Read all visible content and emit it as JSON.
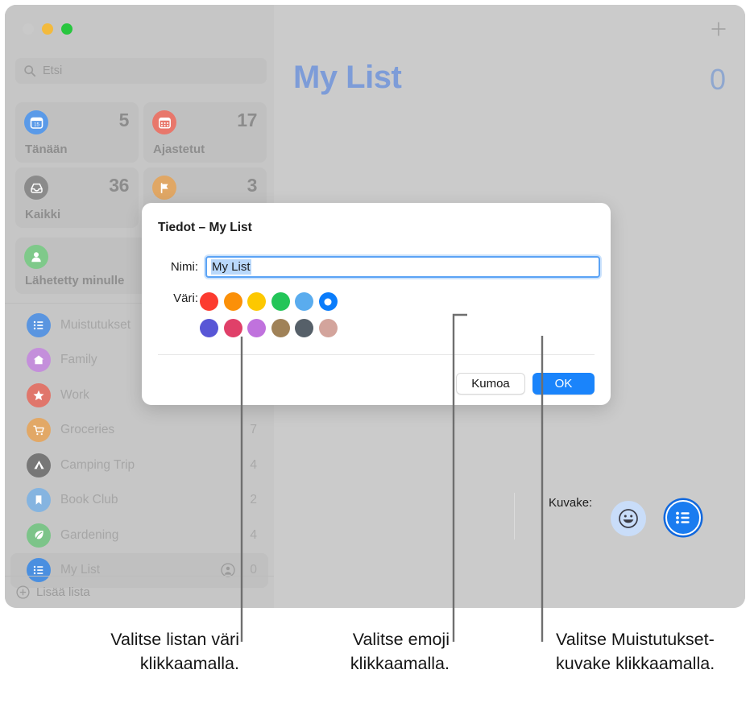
{
  "window": {
    "traffic_lights": [
      "close",
      "minimize",
      "maximize"
    ]
  },
  "sidebar": {
    "search": {
      "placeholder": "Etsi",
      "icon": "search-icon"
    },
    "smart_cards": [
      {
        "label": "Tänään",
        "count": "5",
        "icon": "calendar-day-icon",
        "color": "#5a9ae8"
      },
      {
        "label": "Ajastetut",
        "count": "17",
        "icon": "calendar-icon",
        "color": "#e8776b"
      },
      {
        "label": "Kaikki",
        "count": "36",
        "icon": "tray-icon",
        "color": "#8b8b8b"
      },
      {
        "label": "",
        "count": "3",
        "icon": "flag-icon",
        "color": "#e0a765"
      }
    ],
    "shared_card": {
      "label": "Lähetetty minulle",
      "icon": "person-icon",
      "color": "#7fc98a"
    },
    "lists": [
      {
        "label": "Muistutukset",
        "count": "",
        "icon": "list-bullet-icon",
        "color": "#5a95e0",
        "shared": false,
        "selected": false
      },
      {
        "label": "Family",
        "count": "",
        "icon": "house-icon",
        "color": "#c48fdb",
        "shared": false,
        "selected": false
      },
      {
        "label": "Work",
        "count": "",
        "icon": "star-icon",
        "color": "#e0766b",
        "shared": false,
        "selected": false
      },
      {
        "label": "Groceries",
        "count": "7",
        "icon": "cart-icon",
        "color": "#e2a866",
        "shared": false,
        "selected": false
      },
      {
        "label": "Camping Trip",
        "count": "4",
        "icon": "tent-icon",
        "color": "#777777",
        "shared": false,
        "selected": false
      },
      {
        "label": "Book Club",
        "count": "2",
        "icon": "bookmark-icon",
        "color": "#85b4e0",
        "shared": false,
        "selected": false
      },
      {
        "label": "Gardening",
        "count": "4",
        "icon": "leaf-icon",
        "color": "#7cc489",
        "shared": false,
        "selected": false
      },
      {
        "label": "My List",
        "count": "0",
        "icon": "list-bullet-icon",
        "color": "#4a8fe0",
        "shared": true,
        "selected": true
      }
    ],
    "add_list": {
      "label": "Lisää lista",
      "icon": "plus-circle-icon"
    }
  },
  "detail": {
    "title": "My List",
    "count": "0",
    "add_button_icon": "plus-icon",
    "title_color": "#7d9cd8"
  },
  "sheet": {
    "title": "Tiedot – My List",
    "name_label": "Nimi:",
    "name_value": "My List",
    "color_label": "Väri:",
    "icon_label": "Kuvake:",
    "colors": [
      {
        "name": "red",
        "hex": "#fc3b2f",
        "selected": false
      },
      {
        "name": "orange",
        "hex": "#fb9008",
        "selected": false
      },
      {
        "name": "yellow",
        "hex": "#fdc800",
        "selected": false
      },
      {
        "name": "green",
        "hex": "#23c558",
        "selected": false
      },
      {
        "name": "light-blue",
        "hex": "#5aacee",
        "selected": false
      },
      {
        "name": "blue",
        "hex": "#0a7cfb",
        "selected": true
      },
      {
        "name": "indigo",
        "hex": "#5856d6",
        "selected": false
      },
      {
        "name": "pink",
        "hex": "#e04069",
        "selected": false
      },
      {
        "name": "purple",
        "hex": "#c072dd",
        "selected": false
      },
      {
        "name": "brown",
        "hex": "#a08258",
        "selected": false
      },
      {
        "name": "slate",
        "hex": "#566069",
        "selected": false
      },
      {
        "name": "taupe",
        "hex": "#d3a49c",
        "selected": false
      }
    ],
    "icon_options": [
      {
        "name": "emoji-smiley-icon",
        "selected": false
      },
      {
        "name": "reminders-list-icon",
        "selected": true
      }
    ],
    "cancel_label": "Kumoa",
    "ok_label": "OK"
  },
  "callouts": [
    {
      "id": "color",
      "text": "Valitse listan väri klikkaamalla."
    },
    {
      "id": "emoji",
      "text": "Valitse emoji klikkaamalla."
    },
    {
      "id": "reminders",
      "text": "Valitse Muistutukset-kuvake klikkaamalla."
    }
  ]
}
